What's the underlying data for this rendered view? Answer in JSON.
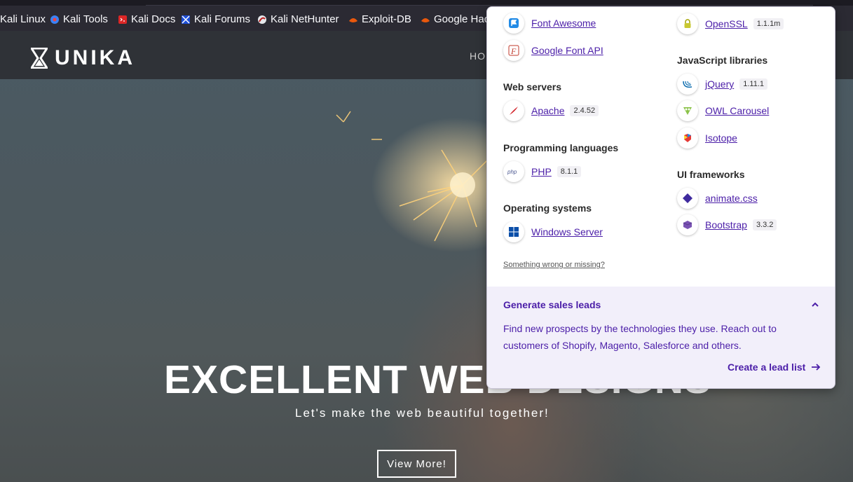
{
  "bookmarks": [
    {
      "label": "Kali Linux",
      "icon": "kali-icon"
    },
    {
      "label": "Kali Tools",
      "icon": "kali-tools-icon"
    },
    {
      "label": "Kali Docs",
      "icon": "kali-docs-icon"
    },
    {
      "label": "Kali Forums",
      "icon": "kali-forums-icon"
    },
    {
      "label": "Kali NetHunter",
      "icon": "nethunter-icon"
    },
    {
      "label": "Exploit-DB",
      "icon": "exploit-db-icon"
    },
    {
      "label": "Google Hac",
      "icon": "google-hacking-icon"
    }
  ],
  "site": {
    "logo_text": "UNIKA",
    "nav_partial": "HO",
    "hero_title": "EXCELLENT WEB DESIGNS",
    "hero_subtitle": "Let's make the web beautiful together!",
    "cta_label": "View More!"
  },
  "popup": {
    "left_column": {
      "top_items": [
        {
          "name": "Font Awesome",
          "version": "",
          "icon": "font-awesome-icon"
        },
        {
          "name": "Google Font API",
          "version": "",
          "icon": "google-font-icon"
        }
      ],
      "web_servers": {
        "heading": "Web servers",
        "items": [
          {
            "name": "Apache",
            "version": "2.4.52",
            "icon": "apache-icon"
          }
        ]
      },
      "programming_languages": {
        "heading": "Programming languages",
        "items": [
          {
            "name": "PHP",
            "version": "8.1.1",
            "icon": "php-icon"
          }
        ]
      },
      "operating_systems": {
        "heading": "Operating systems",
        "items": [
          {
            "name": "Windows Server",
            "version": "",
            "icon": "windows-icon"
          }
        ]
      }
    },
    "right_column": {
      "top_items": [
        {
          "name": "OpenSSL",
          "version": "1.1.1m",
          "icon": "openssl-icon"
        }
      ],
      "javascript_libraries": {
        "heading": "JavaScript libraries",
        "items": [
          {
            "name": "jQuery",
            "version": "1.11.1",
            "icon": "jquery-icon"
          },
          {
            "name": "OWL Carousel",
            "version": "",
            "icon": "owl-carousel-icon"
          },
          {
            "name": "Isotope",
            "version": "",
            "icon": "isotope-icon"
          }
        ]
      },
      "ui_frameworks": {
        "heading": "UI frameworks",
        "items": [
          {
            "name": "animate.css",
            "version": "",
            "icon": "animate-css-icon"
          },
          {
            "name": "Bootstrap",
            "version": "3.3.2",
            "icon": "bootstrap-icon"
          }
        ]
      }
    },
    "feedback_link": "Something wrong or missing?",
    "leads": {
      "title": "Generate sales leads",
      "text": "Find new prospects by the technologies they use. Reach out to customers of Shopify, Magento, Salesforce and others.",
      "cta": "Create a lead list"
    }
  },
  "colors": {
    "accent_purple": "#4b1ea8",
    "leads_bg": "#f2effa",
    "navbar": "#2f3237",
    "bookmarks_bar": "#2b2a33"
  }
}
